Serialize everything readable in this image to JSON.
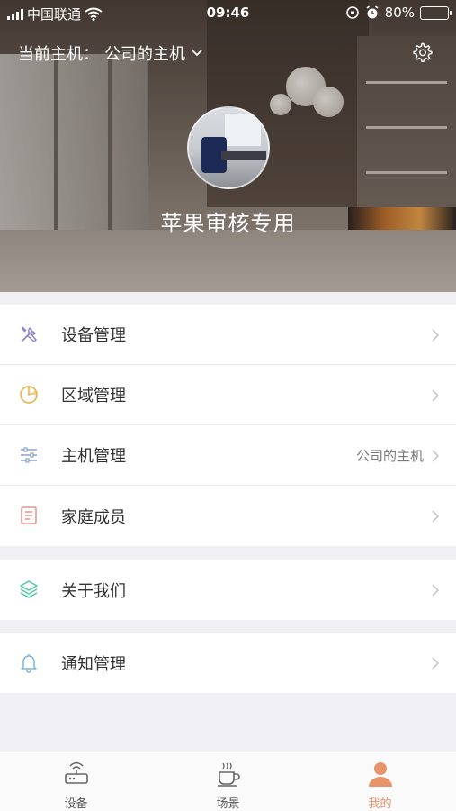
{
  "status_bar": {
    "carrier": "中国联通",
    "time": "09:46",
    "battery": "80%",
    "battery_level": 0.8
  },
  "header": {
    "host_prefix": "当前主机：",
    "host_name": "公司的主机",
    "nickname": "苹果审核专用"
  },
  "menu": {
    "group1": [
      {
        "label": "设备管理",
        "icon": "tools-icon",
        "value": ""
      },
      {
        "label": "区域管理",
        "icon": "pie-chart-icon",
        "value": ""
      },
      {
        "label": "主机管理",
        "icon": "sliders-icon",
        "value": "公司的主机"
      },
      {
        "label": "家庭成员",
        "icon": "document-icon",
        "value": ""
      }
    ],
    "group2": [
      {
        "label": "关于我们",
        "icon": "layers-icon",
        "value": ""
      }
    ],
    "group3": [
      {
        "label": "通知管理",
        "icon": "bell-icon",
        "value": ""
      }
    ]
  },
  "tabbar": {
    "tabs": [
      {
        "label": "设备",
        "icon": "router-icon"
      },
      {
        "label": "场景",
        "icon": "coffee-cup-icon"
      },
      {
        "label": "我的",
        "icon": "person-icon"
      }
    ],
    "active_index": 2
  },
  "colors": {
    "accent": "#e8946a",
    "tools_icon": "#8e7fd4",
    "pie_icon": "#e8b24a",
    "sliders_icon": "#8aa3c9",
    "document_icon": "#e9948a",
    "layers_icon": "#4cc9a0",
    "bell_icon": "#7ab6de"
  }
}
